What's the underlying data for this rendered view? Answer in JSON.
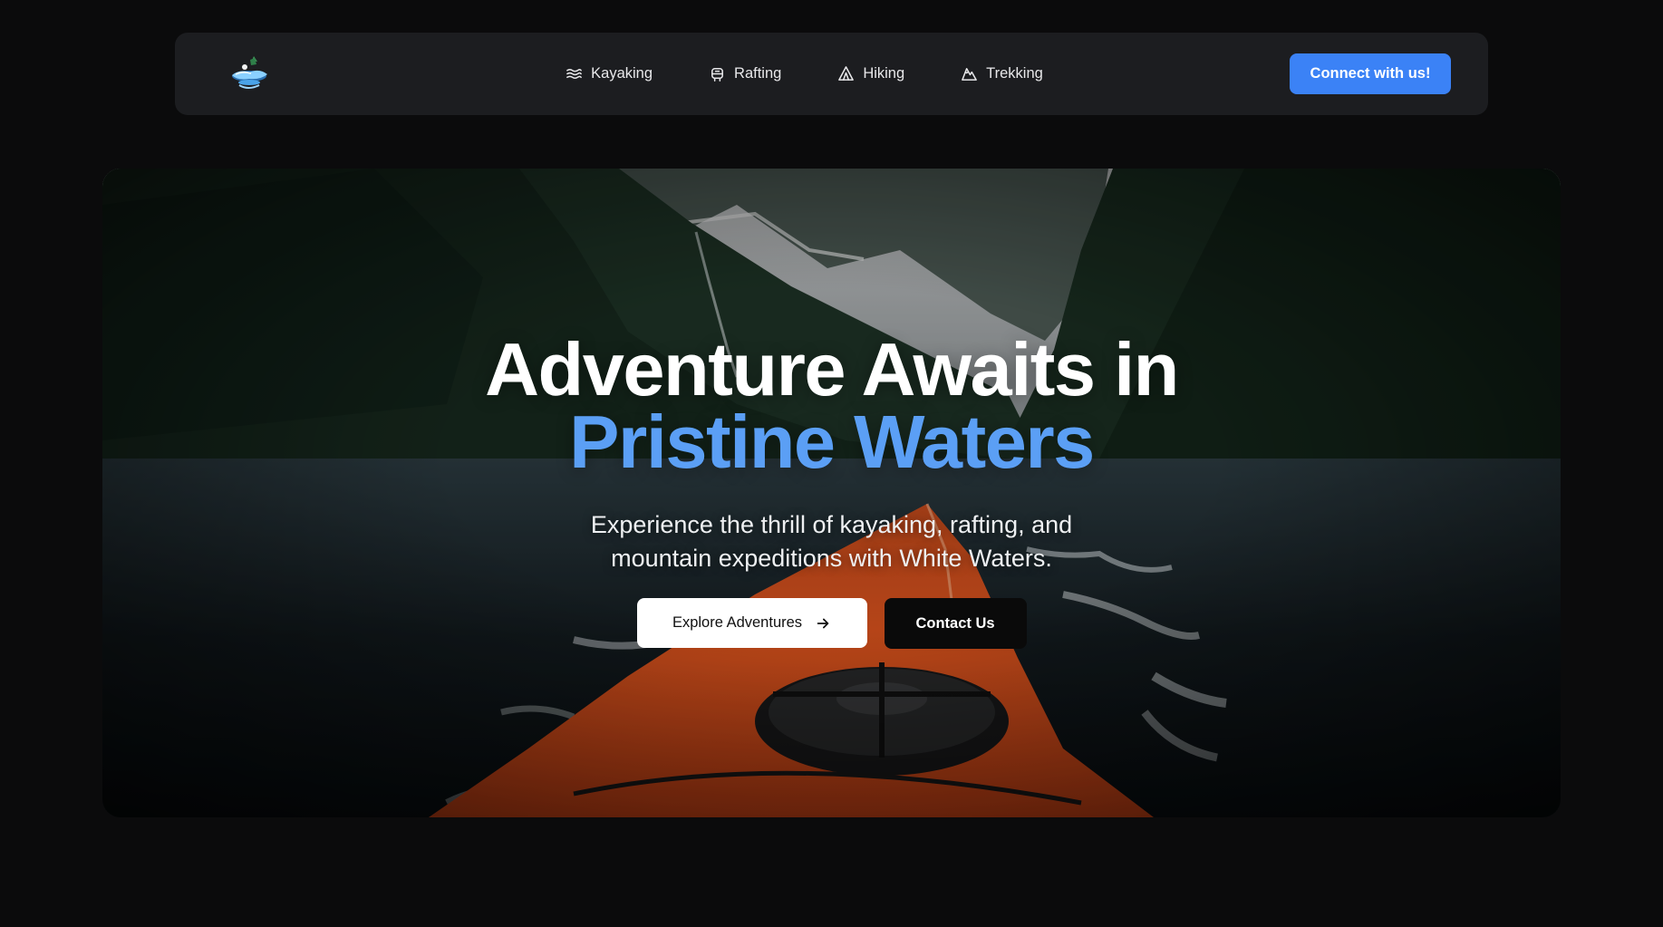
{
  "navbar": {
    "logo_icon": "kayak-splash-logo",
    "links": [
      {
        "label": "Kayaking",
        "icon": "waves-icon"
      },
      {
        "label": "Rafting",
        "icon": "raft-icon"
      },
      {
        "label": "Hiking",
        "icon": "tent-icon"
      },
      {
        "label": "Trekking",
        "icon": "mountain-icon"
      }
    ],
    "cta_label": "Connect with us!"
  },
  "hero": {
    "headline_line1": "Adventure Awaits in",
    "headline_line2": "Pristine Waters",
    "subtitle_line1": "Experience the thrill of kayaking, rafting, and",
    "subtitle_line2": "mountain expeditions with White Waters.",
    "primary_button": "Explore Adventures",
    "secondary_button": "Contact Us"
  },
  "colors": {
    "page_bg": "#0b0b0c",
    "nav_bg": "#1c1d20",
    "accent_blue": "#3b82f6",
    "headline_blue": "#5b9ff5",
    "kayak_orange": "#e0541f"
  }
}
